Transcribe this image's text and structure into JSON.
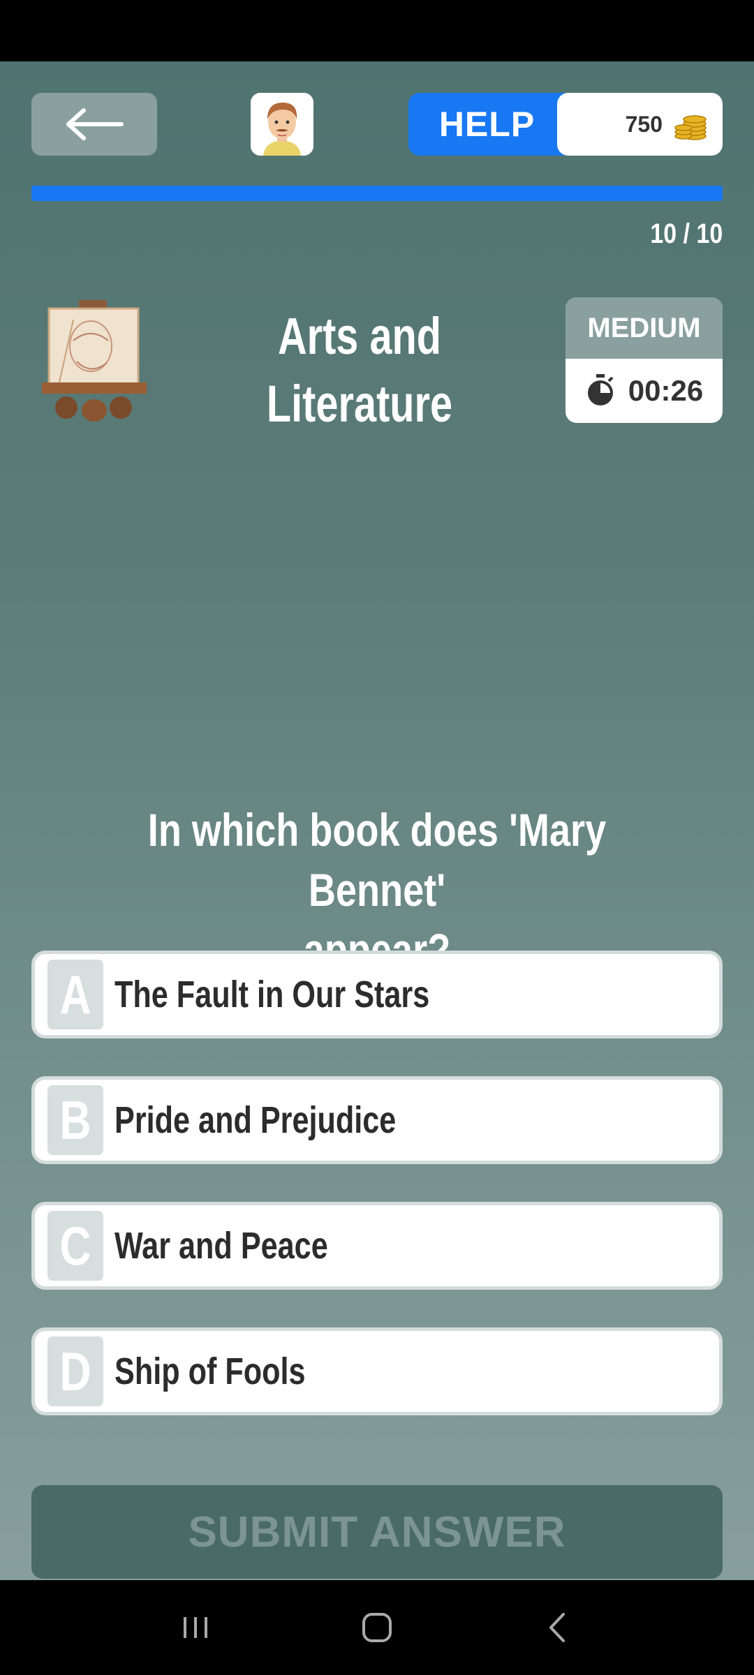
{
  "header": {
    "help_label": "HELP",
    "coins": "750",
    "progress_fraction": 1.0,
    "counter": "10 / 10"
  },
  "category": {
    "title_line1": "Arts and",
    "title_line2": "Literature",
    "difficulty": "MEDIUM",
    "timer": "00:26"
  },
  "question": {
    "text_line1": "In which book does 'Mary Bennet'",
    "text_line2": "appear?"
  },
  "answers": [
    {
      "letter": "A",
      "text": "The Fault in Our Stars"
    },
    {
      "letter": "B",
      "text": "Pride and Prejudice"
    },
    {
      "letter": "C",
      "text": "War and Peace"
    },
    {
      "letter": "D",
      "text": "Ship of Fools"
    }
  ],
  "submit_label": "SUBMIT ANSWER",
  "icons": {
    "back": "arrow-left-icon",
    "avatar": "avatar-icon",
    "coins": "coin-stack-icon",
    "timer": "stopwatch-icon",
    "category": "easel-painting-icon"
  },
  "colors": {
    "accent": "#1877f2",
    "background": "#5e7d79",
    "muted_button": "#8aa09f"
  }
}
